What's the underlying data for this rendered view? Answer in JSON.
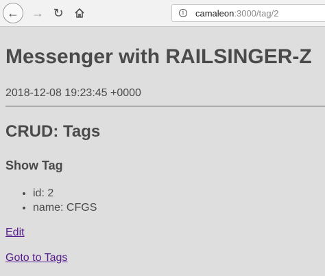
{
  "browser": {
    "url_host": "camaleon",
    "url_rest": ":3000/tag/2"
  },
  "page": {
    "title": "Messenger with RAILSINGER-Z",
    "timestamp": "2018-12-08 19:23:45 +0000",
    "section_title": "CRUD: Tags",
    "subsection_title": "Show Tag",
    "fields": [
      {
        "label": "id: 2"
      },
      {
        "label": "name: CFGS"
      }
    ],
    "edit_link": "Edit",
    "goto_link": "Goto to Tags"
  },
  "icons": {
    "back": "back-arrow-icon",
    "forward": "forward-arrow-icon",
    "reload": "reload-icon",
    "home": "home-icon",
    "info": "info-icon"
  },
  "colors": {
    "page_background": "#dedede",
    "text": "#4a4a4a",
    "link": "#551a8b"
  }
}
